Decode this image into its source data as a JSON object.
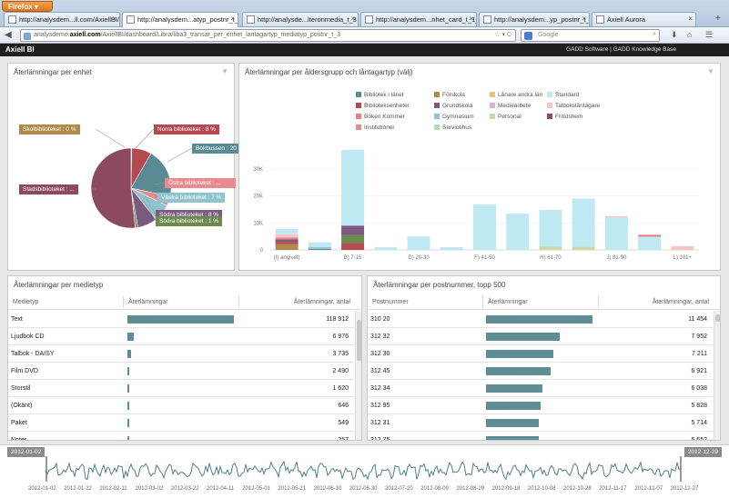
{
  "browser": {
    "firefox_label": "Firefox",
    "tabs": [
      {
        "label": "http://analysdem...ll.com/AxiellBI/",
        "active": false
      },
      {
        "label": "http://analysdem...atyp_postnr_t_3",
        "active": true
      },
      {
        "label": "http://analysde...lteronmedia_t_3",
        "active": false
      },
      {
        "label": "http://analysdem...nhet_card_t_1_2",
        "active": false
      },
      {
        "label": "http://analysdem...yp_postnr_t_1_2",
        "active": false
      },
      {
        "label": "Axiell Aurora",
        "active": false
      }
    ],
    "url_domain": "analysdemo.",
    "url_bold": "axiell.com",
    "url_rest": "/AxiellBI/dashboard/Libra/liba3_transar_per_enhet_lantagartyp_mediatyp_postnr_t_3",
    "search_placeholder": "Google"
  },
  "app": {
    "title": "Axiell BI",
    "links": "GADD Software | GADD Knowledge Base"
  },
  "pie_panel": {
    "title": "Återlämningar per enhet",
    "labels": [
      {
        "text": "Skolbiblioteket : 0 %",
        "color": "#b08a4a"
      },
      {
        "text": "Norra biblioteket : 8 %",
        "color": "#b44a4f"
      },
      {
        "text": "Bokbussen : 20 %",
        "color": "#5a8a93"
      },
      {
        "text": "Östra biblioteket : ...",
        "color": "#e98a8f"
      },
      {
        "text": "Västra biblioteket : 7 %",
        "color": "#8fc4cc"
      },
      {
        "text": "Södra biblioteket : 8 %",
        "color": "#7a5a80"
      },
      {
        "text": "Södra biblioteket : 1 %",
        "color": "#6a8a50"
      },
      {
        "text": "Stadsbiblioteket : ...",
        "color": "#8b4a5f"
      }
    ]
  },
  "chart_data": {
    "type": "bar",
    "title": "Återlämningar per åldersgrupp och låntagartyp (välj)",
    "categories": [
      "(I) angivet)",
      "B) 7-15",
      "D) 20-30",
      "F) 41-50",
      "H) 61-70",
      "J) 81-90",
      "L) 101+"
    ],
    "yticks": [
      "0",
      "10K",
      "20K",
      "30K"
    ],
    "ylim": [
      0,
      37000
    ],
    "legend": [
      {
        "name": "Bibliotek i länet",
        "color": "#5b8a95"
      },
      {
        "name": "Förskola",
        "color": "#b08a4a"
      },
      {
        "name": "Lånare andra län",
        "color": "#e6c27a"
      },
      {
        "name": "Standard",
        "color": "#bfe9f2"
      },
      {
        "name": "Biblioteksenheter",
        "color": "#b44a4f"
      },
      {
        "name": "Grundskola",
        "color": "#7a5a80"
      },
      {
        "name": "Mediearbete",
        "color": "#d6b5d6"
      },
      {
        "name": "Talboksläntagare",
        "color": "#f7c4c4"
      },
      {
        "name": "Boken Kommer",
        "color": "#e97e82"
      },
      {
        "name": "Gymnasium",
        "color": "#8fc4cc"
      },
      {
        "name": "Personal",
        "color": "#c8d8a8"
      },
      {
        "name": "Fritidshem",
        "color": "#8b4a6a"
      },
      {
        "name": "Institutioner",
        "color": "#e08a8a"
      },
      {
        "name": "Servicehus",
        "color": "#b8d8b0"
      }
    ],
    "bars": [
      {
        "total": 7800,
        "segments": [
          {
            "color": "#b08a4a",
            "value": 2200
          },
          {
            "color": "#b44a4f",
            "value": 800
          },
          {
            "color": "#7a5a80",
            "value": 900
          },
          {
            "color": "#e97e82",
            "value": 700
          },
          {
            "color": "#f7c4c4",
            "value": 1200
          },
          {
            "color": "#bfe9f2",
            "value": 2000
          }
        ]
      },
      {
        "total": 2800,
        "segments": [
          {
            "color": "#5b8a95",
            "value": 400
          },
          {
            "color": "#8fc4cc",
            "value": 600
          },
          {
            "color": "#bfe9f2",
            "value": 1800
          }
        ]
      },
      {
        "total": 37000,
        "segments": [
          {
            "color": "#b44a4f",
            "value": 2500
          },
          {
            "color": "#6a8a50",
            "value": 3000
          },
          {
            "color": "#7a5a80",
            "value": 3500
          },
          {
            "color": "#bfe9f2",
            "value": 28000
          }
        ]
      },
      {
        "total": 1000,
        "segments": [
          {
            "color": "#bfe9f2",
            "value": 1000
          }
        ]
      },
      {
        "total": 5000,
        "segments": [
          {
            "color": "#bfe9f2",
            "value": 5000
          }
        ]
      },
      {
        "total": 1000,
        "segments": [
          {
            "color": "#bfe9f2",
            "value": 1000
          }
        ]
      },
      {
        "total": 16800,
        "segments": [
          {
            "color": "#bfe9f2",
            "value": 16800
          }
        ]
      },
      {
        "total": 13400,
        "segments": [
          {
            "color": "#bfe9f2",
            "value": 13400
          }
        ]
      },
      {
        "total": 14800,
        "segments": [
          {
            "color": "#c8d8a8",
            "value": 1300
          },
          {
            "color": "#bfe9f2",
            "value": 13500
          }
        ]
      },
      {
        "total": 19000,
        "segments": [
          {
            "color": "#c8d8a8",
            "value": 1200
          },
          {
            "color": "#bfe9f2",
            "value": 17800
          }
        ]
      },
      {
        "total": 12500,
        "segments": [
          {
            "color": "#bfe9f2",
            "value": 12000
          },
          {
            "color": "#f7c4c4",
            "value": 500
          }
        ]
      },
      {
        "total": 5600,
        "segments": [
          {
            "color": "#bfe9f2",
            "value": 4900
          },
          {
            "color": "#e97e82",
            "value": 700
          }
        ]
      },
      {
        "total": 1400,
        "segments": [
          {
            "color": "#f7c4c4",
            "value": 1400
          }
        ]
      }
    ]
  },
  "media_panel": {
    "title": "Återlämningar per medietyp",
    "col1": "Medietyp",
    "col2": "Återlämningar",
    "col3": "Återlämningar, antal",
    "max": 118912,
    "rows": [
      {
        "name": "Text",
        "value": 118912,
        "label": "118 912"
      },
      {
        "name": "Ljudbok CD",
        "value": 6976,
        "label": "6 976"
      },
      {
        "name": "Talbok - DAISY",
        "value": 3735,
        "label": "3 735"
      },
      {
        "name": "Film DVD",
        "value": 2490,
        "label": "2 490"
      },
      {
        "name": "Storstil",
        "value": 1620,
        "label": "1 620"
      },
      {
        "name": "(Okänt)",
        "value": 646,
        "label": "646"
      },
      {
        "name": "Paket",
        "value": 549,
        "label": "549"
      },
      {
        "name": "Noter",
        "value": 257,
        "label": "257"
      }
    ]
  },
  "postnr_panel": {
    "title": "Återlämningar per postnummer, topp 500",
    "col1": "Postnummer",
    "col2": "Återlämningar",
    "col3": "Återlämningar, antal",
    "max": 11454,
    "rows": [
      {
        "name": "310 20",
        "value": 11454,
        "label": "11 454"
      },
      {
        "name": "312 32",
        "value": 7952,
        "label": "7 952"
      },
      {
        "name": "312 30",
        "value": 7211,
        "label": "7 211"
      },
      {
        "name": "312 45",
        "value": 6921,
        "label": "6 921"
      },
      {
        "name": "312 34",
        "value": 6038,
        "label": "6 038"
      },
      {
        "name": "312 95",
        "value": 5828,
        "label": "5 828"
      },
      {
        "name": "312 31",
        "value": 5714,
        "label": "5 714"
      },
      {
        "name": "312 75",
        "value": 5652,
        "label": "5 652"
      }
    ]
  },
  "timeline": {
    "start": "2012-01-02",
    "end": "2012-12-29",
    "ticks": [
      "2012-01-02",
      "2012-01-22",
      "2012-02-11",
      "2012-03-02",
      "2012-03-22",
      "2012-04-11",
      "2012-05-01",
      "2012-05-21",
      "2012-06-10",
      "2012-06-30",
      "2012-07-20",
      "2012-08-09",
      "2012-08-29",
      "2012-09-18",
      "2012-10-08",
      "2012-10-28",
      "2012-11-17",
      "2012-12-07",
      "2012-12-27"
    ]
  }
}
